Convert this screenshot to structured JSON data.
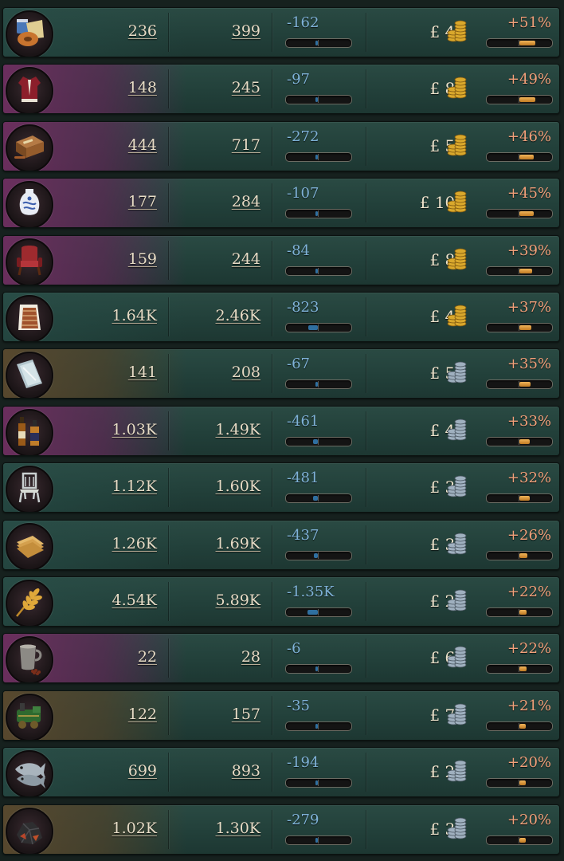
{
  "currency_symbol": "£",
  "colors": {
    "balance_text": "#7fb2d8",
    "percent_text": "#f2a07a",
    "value_text": "#e7dcc6",
    "gold_coin": "#d9a82c",
    "silver_coin": "#9fb0bf"
  },
  "goods": [
    {
      "icon": "groceries-icon",
      "category": "stap",
      "supply": "236",
      "demand": "399",
      "balance": "-162",
      "balance_level": 0.05,
      "price": "45",
      "coin": "gold-coins-icon",
      "price_change": "+51%",
      "change_level": 0.51
    },
    {
      "icon": "clothes-icon",
      "category": "lux",
      "supply": "148",
      "demand": "245",
      "balance": "-97",
      "balance_level": 0.04,
      "price": "89",
      "coin": "gold-coins-icon",
      "price_change": "+49%",
      "change_level": 0.49
    },
    {
      "icon": "tobacco-icon",
      "category": "lux",
      "supply": "444",
      "demand": "717",
      "balance": "-272",
      "balance_level": 0.08,
      "price": "58",
      "coin": "gold-coins-icon",
      "price_change": "+46%",
      "change_level": 0.46
    },
    {
      "icon": "porcelain-icon",
      "category": "lux",
      "supply": "177",
      "demand": "284",
      "balance": "-107",
      "balance_level": 0.04,
      "price": "101",
      "coin": "gold-coins-icon",
      "price_change": "+45%",
      "change_level": 0.45
    },
    {
      "icon": "luxury-furniture-icon",
      "category": "lux",
      "supply": "159",
      "demand": "244",
      "balance": "-84",
      "balance_level": 0.03,
      "price": "83",
      "coin": "gold-coins-icon",
      "price_change": "+39%",
      "change_level": 0.39
    },
    {
      "icon": "fabric-icon",
      "category": "stap",
      "supply": "1.64K",
      "demand": "2.46K",
      "balance": "-823",
      "balance_level": 0.3,
      "price": "41",
      "coin": "gold-coins-icon",
      "price_change": "+37%",
      "change_level": 0.37
    },
    {
      "icon": "glass-icon",
      "category": "ind",
      "supply": "141",
      "demand": "208",
      "balance": "-67",
      "balance_level": 0.03,
      "price": "54",
      "coin": "silver-coins-icon",
      "price_change": "+35%",
      "change_level": 0.35
    },
    {
      "icon": "liquor-icon",
      "category": "lux",
      "supply": "1.03K",
      "demand": "1.49K",
      "balance": "-461",
      "balance_level": 0.15,
      "price": "40",
      "coin": "silver-coins-icon",
      "price_change": "+33%",
      "change_level": 0.33
    },
    {
      "icon": "furniture-icon",
      "category": "stap",
      "supply": "1.12K",
      "demand": "1.60K",
      "balance": "-481",
      "balance_level": 0.15,
      "price": "39",
      "coin": "silver-coins-icon",
      "price_change": "+32%",
      "change_level": 0.32
    },
    {
      "icon": "paper-icon",
      "category": "stap",
      "supply": "1.26K",
      "demand": "1.69K",
      "balance": "-437",
      "balance_level": 0.13,
      "price": "37",
      "coin": "silver-coins-icon",
      "price_change": "+26%",
      "change_level": 0.26
    },
    {
      "icon": "grain-icon",
      "category": "stap",
      "supply": "4.54K",
      "demand": "5.89K",
      "balance": "-1.35K",
      "balance_level": 0.32,
      "price": "24",
      "coin": "silver-coins-icon",
      "price_change": "+22%",
      "change_level": 0.22
    },
    {
      "icon": "wine-icon",
      "category": "lux",
      "supply": "22",
      "demand": "28",
      "balance": "-6",
      "balance_level": 0.01,
      "price": "61",
      "coin": "silver-coins-icon",
      "price_change": "+22%",
      "change_level": 0.22
    },
    {
      "icon": "engines-icon",
      "category": "ind",
      "supply": "122",
      "demand": "157",
      "balance": "-35",
      "balance_level": 0.02,
      "price": "73",
      "coin": "silver-coins-icon",
      "price_change": "+21%",
      "change_level": 0.21
    },
    {
      "icon": "fish-icon",
      "category": "stap",
      "supply": "699",
      "demand": "893",
      "balance": "-194",
      "balance_level": 0.05,
      "price": "24",
      "coin": "silver-coins-icon",
      "price_change": "+20%",
      "change_level": 0.2
    },
    {
      "icon": "coal-icon",
      "category": "ind",
      "supply": "1.02K",
      "demand": "1.30K",
      "balance": "-279",
      "balance_level": 0.08,
      "price": "36",
      "coin": "silver-coins-icon",
      "price_change": "+20%",
      "change_level": 0.2
    }
  ]
}
